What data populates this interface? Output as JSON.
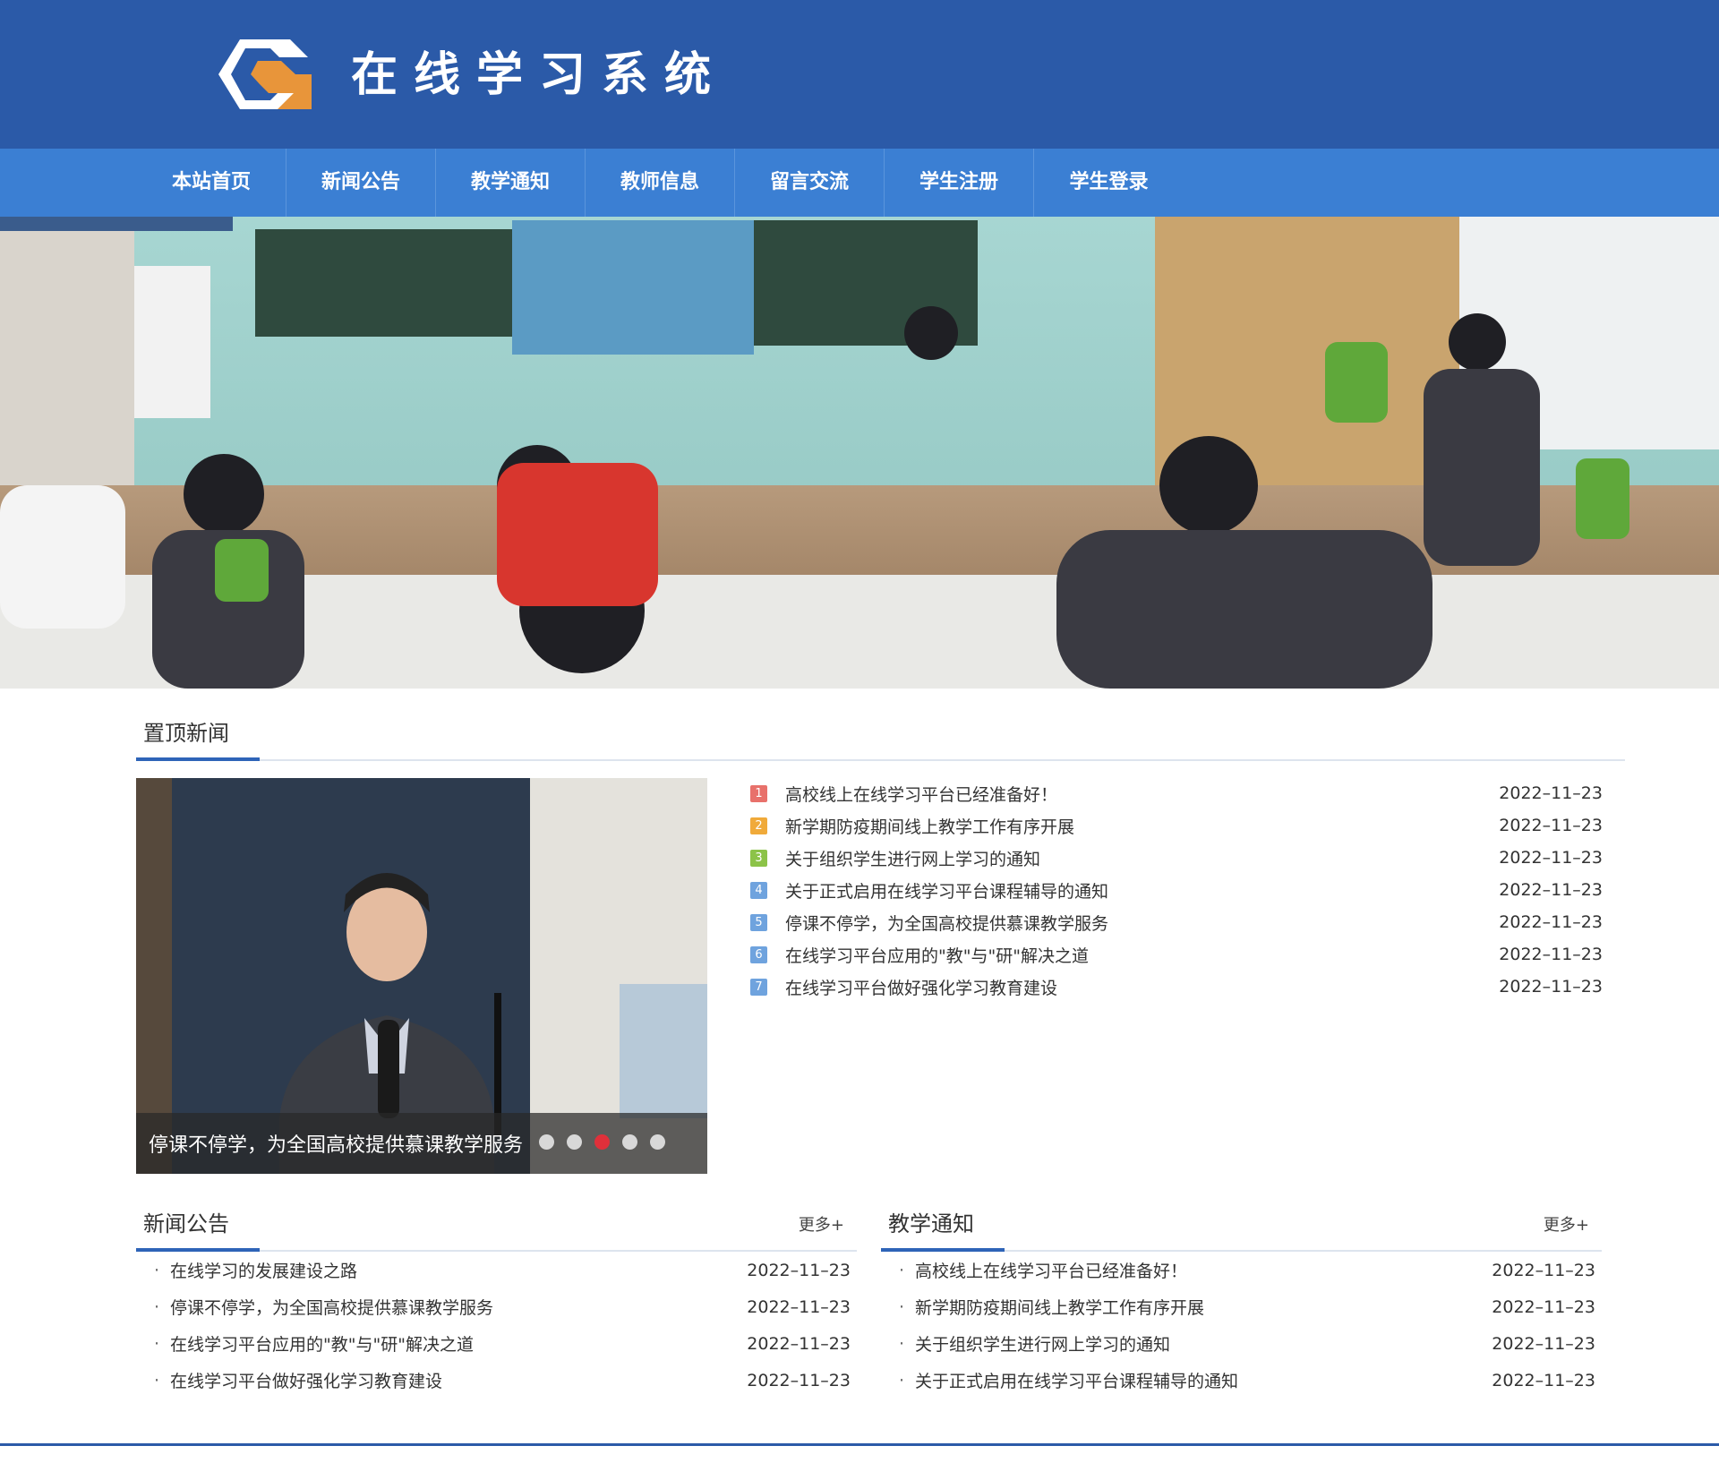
{
  "header": {
    "title": "在线学习系统",
    "logo_icon": "hexagon-g-logo-icon"
  },
  "nav": {
    "items": [
      "本站首页",
      "新闻公告",
      "教学通知",
      "教师信息",
      "留言交流",
      "学生注册",
      "学生登录"
    ]
  },
  "colors": {
    "header_bg": "#2b5aa8",
    "nav_bg": "#3b7fd3",
    "accent": "#2e64b8",
    "active_dot": "#e0303a"
  },
  "top_news": {
    "title": "置顶新闻",
    "slider": {
      "caption": "停课不停学，为全国高校提供慕课教学服务",
      "dot_count": 5,
      "active_dot": 3
    },
    "items": [
      {
        "num": "1",
        "title": "高校线上在线学习平台已经准备好！",
        "date": "2022–11–23",
        "color": "#e8716b"
      },
      {
        "num": "2",
        "title": "新学期防疫期间线上教学工作有序开展",
        "date": "2022–11–23",
        "color": "#f0aa3a"
      },
      {
        "num": "3",
        "title": "关于组织学生进行网上学习的通知",
        "date": "2022–11–23",
        "color": "#8cc348"
      },
      {
        "num": "4",
        "title": "关于正式启用在线学习平台课程辅导的通知",
        "date": "2022–11–23",
        "color": "#6fa3de"
      },
      {
        "num": "5",
        "title": "停课不停学，为全国高校提供慕课教学服务",
        "date": "2022–11–23",
        "color": "#6fa3de"
      },
      {
        "num": "6",
        "title": "在线学习平台应用的\"教\"与\"研\"解决之道",
        "date": "2022–11–23",
        "color": "#6fa3de"
      },
      {
        "num": "7",
        "title": "在线学习平台做好强化学习教育建设",
        "date": "2022–11–23",
        "color": "#6fa3de"
      }
    ]
  },
  "news": {
    "title": "新闻公告",
    "more": "更多+",
    "items": [
      {
        "title": "在线学习的发展建设之路",
        "date": "2022–11–23"
      },
      {
        "title": "停课不停学，为全国高校提供慕课教学服务",
        "date": "2022–11–23"
      },
      {
        "title": "在线学习平台应用的\"教\"与\"研\"解决之道",
        "date": "2022–11–23"
      },
      {
        "title": "在线学习平台做好强化学习教育建设",
        "date": "2022–11–23"
      }
    ]
  },
  "notice": {
    "title": "教学通知",
    "more": "更多+",
    "items": [
      {
        "title": "高校线上在线学习平台已经准备好！",
        "date": "2022–11–23"
      },
      {
        "title": "新学期防疫期间线上教学工作有序开展",
        "date": "2022–11–23"
      },
      {
        "title": "关于组织学生进行网上学习的通知",
        "date": "2022–11–23"
      },
      {
        "title": "关于正式启用在线学习平台课程辅导的通知",
        "date": "2022–11–23"
      }
    ]
  }
}
